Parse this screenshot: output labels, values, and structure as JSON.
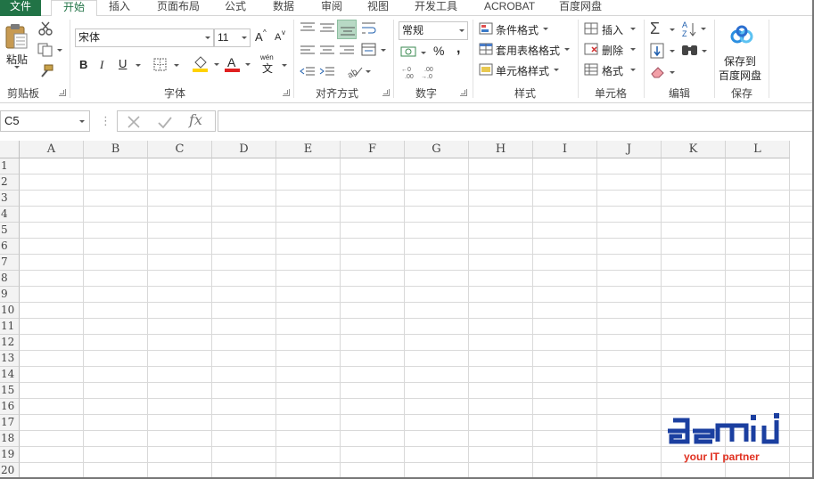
{
  "tabs": {
    "file": "文件",
    "items": [
      "开始",
      "插入",
      "页面布局",
      "公式",
      "数据",
      "审阅",
      "视图",
      "开发工具",
      "ACROBAT",
      "百度网盘"
    ]
  },
  "clipboard": {
    "paste": "粘贴",
    "label": "剪贴板"
  },
  "font": {
    "name": "宋体",
    "size": "11",
    "bold": "B",
    "italic": "I",
    "underline": "U",
    "grow": "A",
    "shrink": "A",
    "color_letter": "A",
    "phonetic": "wén",
    "label": "字体"
  },
  "alignment": {
    "label": "对齐方式"
  },
  "number": {
    "format": "常规",
    "percent": "%",
    "comma": ",",
    "label": "数字"
  },
  "styles": {
    "conditional": "条件格式",
    "table": "套用表格格式",
    "cell": "单元格样式",
    "label": "样式"
  },
  "cells": {
    "insert": "插入",
    "delete": "删除",
    "format": "格式",
    "label": "单元格"
  },
  "editing": {
    "label": "编辑"
  },
  "save": {
    "line1": "保存到",
    "line2": "百度网盘",
    "label": "保存"
  },
  "formula_bar": {
    "name_box": "C5",
    "fx": "fx",
    "value": ""
  },
  "columns": [
    "A",
    "B",
    "C",
    "D",
    "E",
    "F",
    "G",
    "H",
    "I",
    "J",
    "K",
    "L"
  ],
  "rows": [
    "1",
    "2",
    "3",
    "4",
    "5",
    "6",
    "7",
    "8",
    "9",
    "10",
    "11",
    "12",
    "13",
    "14",
    "15",
    "16",
    "17",
    "18",
    "19",
    "20"
  ],
  "logo": {
    "tagline": "your IT partner"
  },
  "colors": {
    "excel_green": "#217346",
    "logo_blue": "#1b3fa0",
    "logo_red": "#e03020",
    "fill_yellow": "#ffd200",
    "font_red": "#e02020",
    "align_active": "#b8d9c5"
  }
}
